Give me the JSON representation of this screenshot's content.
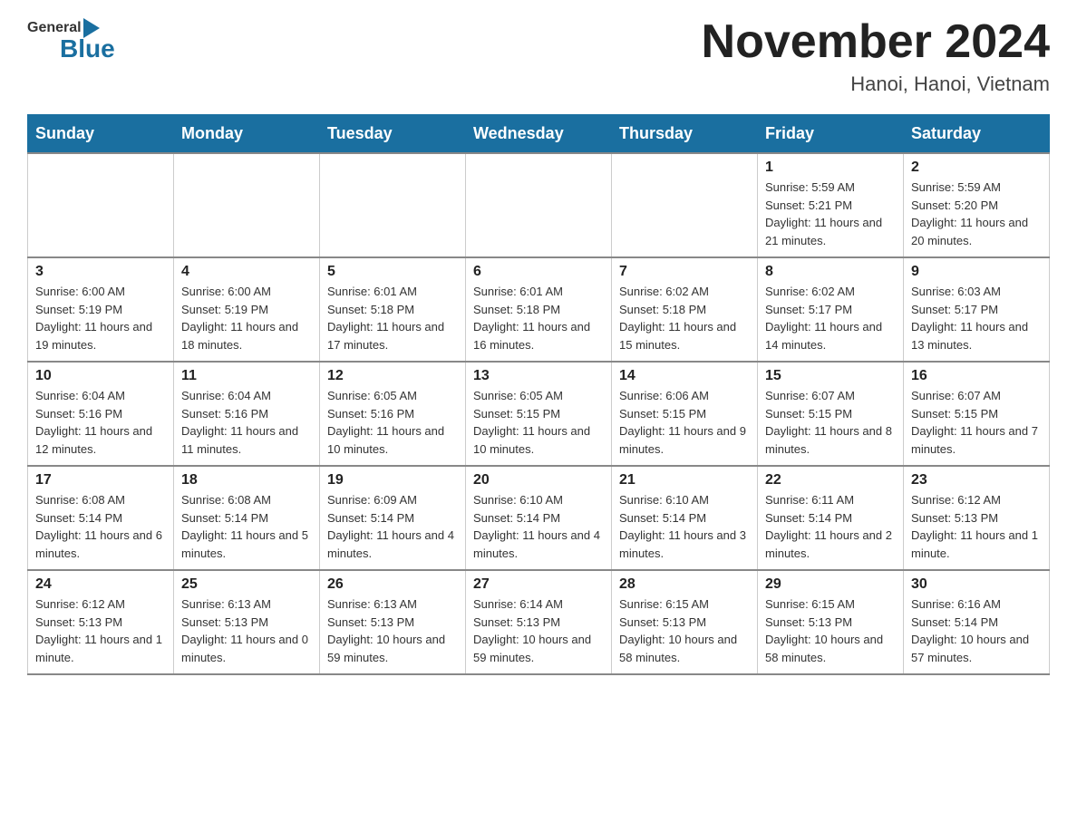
{
  "header": {
    "logo_general": "General",
    "logo_blue": "Blue",
    "month_title": "November 2024",
    "location": "Hanoi, Hanoi, Vietnam"
  },
  "days_of_week": [
    "Sunday",
    "Monday",
    "Tuesday",
    "Wednesday",
    "Thursday",
    "Friday",
    "Saturday"
  ],
  "weeks": [
    [
      {
        "day": "",
        "info": ""
      },
      {
        "day": "",
        "info": ""
      },
      {
        "day": "",
        "info": ""
      },
      {
        "day": "",
        "info": ""
      },
      {
        "day": "",
        "info": ""
      },
      {
        "day": "1",
        "info": "Sunrise: 5:59 AM\nSunset: 5:21 PM\nDaylight: 11 hours and 21 minutes."
      },
      {
        "day": "2",
        "info": "Sunrise: 5:59 AM\nSunset: 5:20 PM\nDaylight: 11 hours and 20 minutes."
      }
    ],
    [
      {
        "day": "3",
        "info": "Sunrise: 6:00 AM\nSunset: 5:19 PM\nDaylight: 11 hours and 19 minutes."
      },
      {
        "day": "4",
        "info": "Sunrise: 6:00 AM\nSunset: 5:19 PM\nDaylight: 11 hours and 18 minutes."
      },
      {
        "day": "5",
        "info": "Sunrise: 6:01 AM\nSunset: 5:18 PM\nDaylight: 11 hours and 17 minutes."
      },
      {
        "day": "6",
        "info": "Sunrise: 6:01 AM\nSunset: 5:18 PM\nDaylight: 11 hours and 16 minutes."
      },
      {
        "day": "7",
        "info": "Sunrise: 6:02 AM\nSunset: 5:18 PM\nDaylight: 11 hours and 15 minutes."
      },
      {
        "day": "8",
        "info": "Sunrise: 6:02 AM\nSunset: 5:17 PM\nDaylight: 11 hours and 14 minutes."
      },
      {
        "day": "9",
        "info": "Sunrise: 6:03 AM\nSunset: 5:17 PM\nDaylight: 11 hours and 13 minutes."
      }
    ],
    [
      {
        "day": "10",
        "info": "Sunrise: 6:04 AM\nSunset: 5:16 PM\nDaylight: 11 hours and 12 minutes."
      },
      {
        "day": "11",
        "info": "Sunrise: 6:04 AM\nSunset: 5:16 PM\nDaylight: 11 hours and 11 minutes."
      },
      {
        "day": "12",
        "info": "Sunrise: 6:05 AM\nSunset: 5:16 PM\nDaylight: 11 hours and 10 minutes."
      },
      {
        "day": "13",
        "info": "Sunrise: 6:05 AM\nSunset: 5:15 PM\nDaylight: 11 hours and 10 minutes."
      },
      {
        "day": "14",
        "info": "Sunrise: 6:06 AM\nSunset: 5:15 PM\nDaylight: 11 hours and 9 minutes."
      },
      {
        "day": "15",
        "info": "Sunrise: 6:07 AM\nSunset: 5:15 PM\nDaylight: 11 hours and 8 minutes."
      },
      {
        "day": "16",
        "info": "Sunrise: 6:07 AM\nSunset: 5:15 PM\nDaylight: 11 hours and 7 minutes."
      }
    ],
    [
      {
        "day": "17",
        "info": "Sunrise: 6:08 AM\nSunset: 5:14 PM\nDaylight: 11 hours and 6 minutes."
      },
      {
        "day": "18",
        "info": "Sunrise: 6:08 AM\nSunset: 5:14 PM\nDaylight: 11 hours and 5 minutes."
      },
      {
        "day": "19",
        "info": "Sunrise: 6:09 AM\nSunset: 5:14 PM\nDaylight: 11 hours and 4 minutes."
      },
      {
        "day": "20",
        "info": "Sunrise: 6:10 AM\nSunset: 5:14 PM\nDaylight: 11 hours and 4 minutes."
      },
      {
        "day": "21",
        "info": "Sunrise: 6:10 AM\nSunset: 5:14 PM\nDaylight: 11 hours and 3 minutes."
      },
      {
        "day": "22",
        "info": "Sunrise: 6:11 AM\nSunset: 5:14 PM\nDaylight: 11 hours and 2 minutes."
      },
      {
        "day": "23",
        "info": "Sunrise: 6:12 AM\nSunset: 5:13 PM\nDaylight: 11 hours and 1 minute."
      }
    ],
    [
      {
        "day": "24",
        "info": "Sunrise: 6:12 AM\nSunset: 5:13 PM\nDaylight: 11 hours and 1 minute."
      },
      {
        "day": "25",
        "info": "Sunrise: 6:13 AM\nSunset: 5:13 PM\nDaylight: 11 hours and 0 minutes."
      },
      {
        "day": "26",
        "info": "Sunrise: 6:13 AM\nSunset: 5:13 PM\nDaylight: 10 hours and 59 minutes."
      },
      {
        "day": "27",
        "info": "Sunrise: 6:14 AM\nSunset: 5:13 PM\nDaylight: 10 hours and 59 minutes."
      },
      {
        "day": "28",
        "info": "Sunrise: 6:15 AM\nSunset: 5:13 PM\nDaylight: 10 hours and 58 minutes."
      },
      {
        "day": "29",
        "info": "Sunrise: 6:15 AM\nSunset: 5:13 PM\nDaylight: 10 hours and 58 minutes."
      },
      {
        "day": "30",
        "info": "Sunrise: 6:16 AM\nSunset: 5:14 PM\nDaylight: 10 hours and 57 minutes."
      }
    ]
  ]
}
